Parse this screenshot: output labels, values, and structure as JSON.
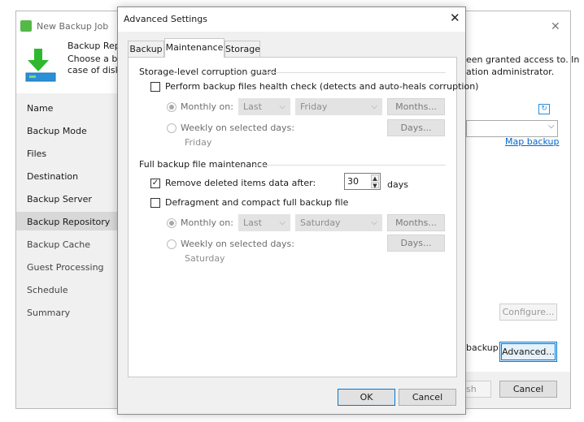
{
  "background_window": {
    "title": "New Backup Job",
    "header": {
      "title": "Backup Repo",
      "desc_line1": "Choose a ba",
      "desc_line2": "case of disk s",
      "right_line1": "een granted access to. In",
      "right_line2": "ation administrator."
    },
    "sidebar": {
      "items": [
        {
          "label": "Name"
        },
        {
          "label": "Backup Mode"
        },
        {
          "label": "Files"
        },
        {
          "label": "Destination"
        },
        {
          "label": "Backup Server"
        },
        {
          "label": "Backup Repository"
        },
        {
          "label": "Backup Cache"
        },
        {
          "label": "Guest Processing"
        },
        {
          "label": "Schedule"
        },
        {
          "label": "Summary"
        }
      ],
      "selected": "Backup Repository"
    },
    "main": {
      "map_backup_link": "Map backup",
      "configure_label": "Configure...",
      "backup_text": "backup",
      "advanced_label": "Advanced..."
    },
    "footer": {
      "finish_partial": "sh",
      "cancel_label": "Cancel"
    }
  },
  "dialog": {
    "title": "Advanced Settings",
    "tabs": [
      {
        "label": "Backup"
      },
      {
        "label": "Maintenance"
      },
      {
        "label": "Storage"
      }
    ],
    "active_tab": "Maintenance",
    "storage_guard": {
      "group_title": "Storage-level corruption guard",
      "health_check_label": "Perform backup files health check (detects and auto-heals corruption)",
      "health_check_checked": false,
      "monthly_label": "Monthly on:",
      "monthly_week": "Last",
      "monthly_day": "Friday",
      "months_button": "Months...",
      "weekly_label": "Weekly on selected days:",
      "days_button": "Days...",
      "weekly_days": "Friday"
    },
    "full_maintenance": {
      "group_title": "Full backup file maintenance",
      "remove_label": "Remove deleted items data after:",
      "remove_checked": true,
      "remove_value": "30",
      "remove_unit": "days",
      "defrag_label": "Defragment and compact full backup file",
      "defrag_checked": false,
      "monthly_label": "Monthly on:",
      "monthly_week": "Last",
      "monthly_day": "Saturday",
      "months_button": "Months...",
      "weekly_label": "Weekly on selected days:",
      "days_button": "Days...",
      "weekly_days": "Saturday"
    },
    "ok_label": "OK",
    "cancel_label": "Cancel"
  }
}
